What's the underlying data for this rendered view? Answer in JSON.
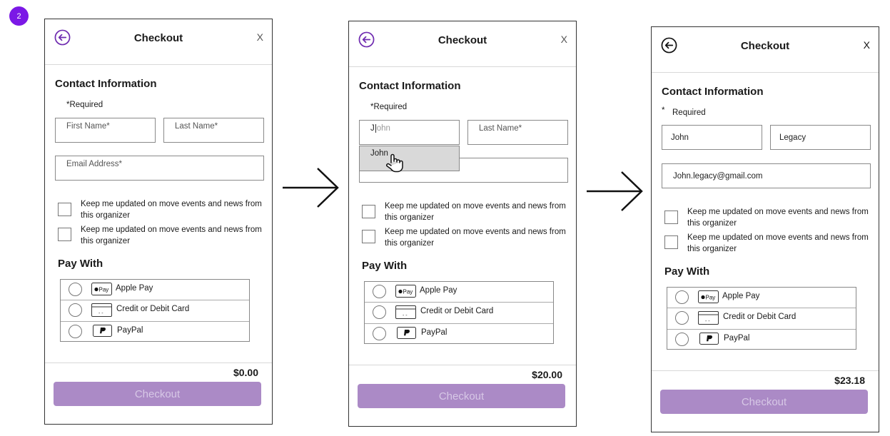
{
  "step_badge": "2",
  "screens": [
    {
      "title": "Checkout",
      "close": "X",
      "contact_title": "Contact Information",
      "required_note": "*Required",
      "first_name": {
        "placeholder": "First Name*"
      },
      "last_name": {
        "placeholder": "Last Name*"
      },
      "email": {
        "placeholder": "Email Address*"
      },
      "checkboxes": [
        "Keep me updated on move events and news from",
        "this organizer",
        "Keep me updated on move events and news from",
        "this organizer"
      ],
      "pay_title": "Pay With",
      "pay_options": [
        "Apple Pay",
        "Credit or Debit Card",
        "PayPal"
      ],
      "total": "$0.00",
      "checkout_label": "Checkout"
    },
    {
      "title": "Checkout",
      "close": "X",
      "contact_title": "Contact Information",
      "required_note": "*Required",
      "first_name": {
        "typed": "J",
        "ghost": "ohn"
      },
      "last_name": {
        "placeholder": "Last Name*"
      },
      "suggestion": "John",
      "checkboxes": [
        "Keep me updated on move events and news from",
        "this organizer",
        "Keep me updated on move events and news from",
        "this organizer"
      ],
      "pay_title": "Pay With",
      "pay_options": [
        "Apple Pay",
        "Credit or Debit Card",
        "PayPal"
      ],
      "total": "$20.00",
      "checkout_label": "Checkout"
    },
    {
      "title": "Checkout",
      "close": "X",
      "contact_title": "Contact Information",
      "required_star": "*",
      "required_note": "Required",
      "first_name": {
        "value": "John"
      },
      "last_name": {
        "value": "Legacy"
      },
      "email": {
        "value": "John.legacy@gmail.com"
      },
      "checkboxes": [
        "Keep me updated on move events and news from",
        "this organizer",
        "Keep me updated on move events and news from",
        "this organizer"
      ],
      "pay_title": "Pay With",
      "pay_options": [
        "Apple Pay",
        "Credit or Debit Card",
        "PayPal"
      ],
      "total": "$23.18",
      "checkout_label": "Checkout"
    }
  ],
  "apple_pay_icon_text": "Pay",
  "card_icon_text": "- -",
  "colors": {
    "accent": "#7b18e6",
    "button": "#ab8ac6",
    "button_text": "#d7c8e6",
    "suggestion_bg": "#d9d9d9"
  }
}
